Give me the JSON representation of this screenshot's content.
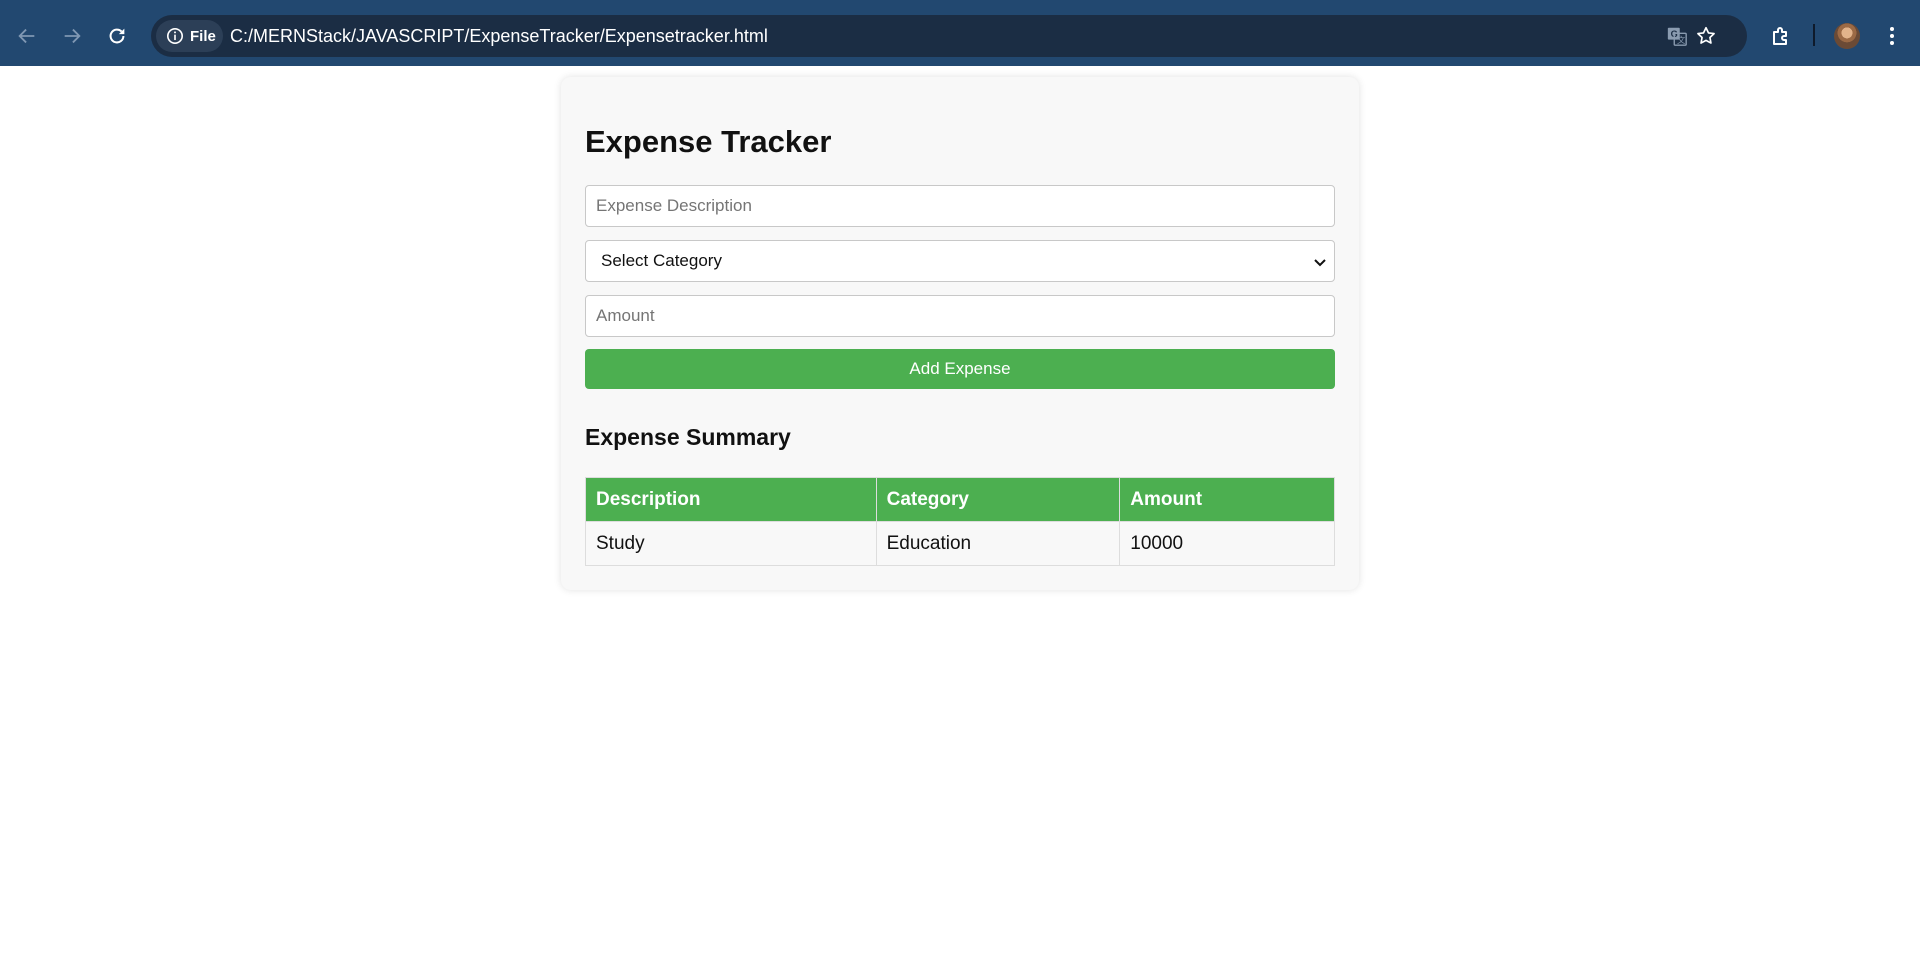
{
  "browser": {
    "scheme_chip": "File",
    "url": "C:/MERNStack/JAVASCRIPT/ExpenseTracker/Expensetracker.html",
    "icons": [
      "back-arrow-icon",
      "forward-arrow-icon",
      "reload-icon",
      "info-icon",
      "translate-icon",
      "star-icon",
      "extensions-icon",
      "profile-avatar",
      "more-menu-icon"
    ]
  },
  "page": {
    "title": "Expense Tracker",
    "description_placeholder": "Expense Description",
    "category_selected": "Select Category",
    "amount_placeholder": "Amount",
    "add_button": "Add Expense",
    "summary_title": "Expense Summary",
    "table": {
      "headers": [
        "Description",
        "Category",
        "Amount"
      ],
      "rows": [
        [
          "Study",
          "Education",
          "10000"
        ]
      ]
    }
  },
  "colors": {
    "toolbar": "#224870",
    "omnibox": "#1b2d44",
    "accent_green": "#4caf50",
    "card_bg": "#f8f8f8"
  }
}
